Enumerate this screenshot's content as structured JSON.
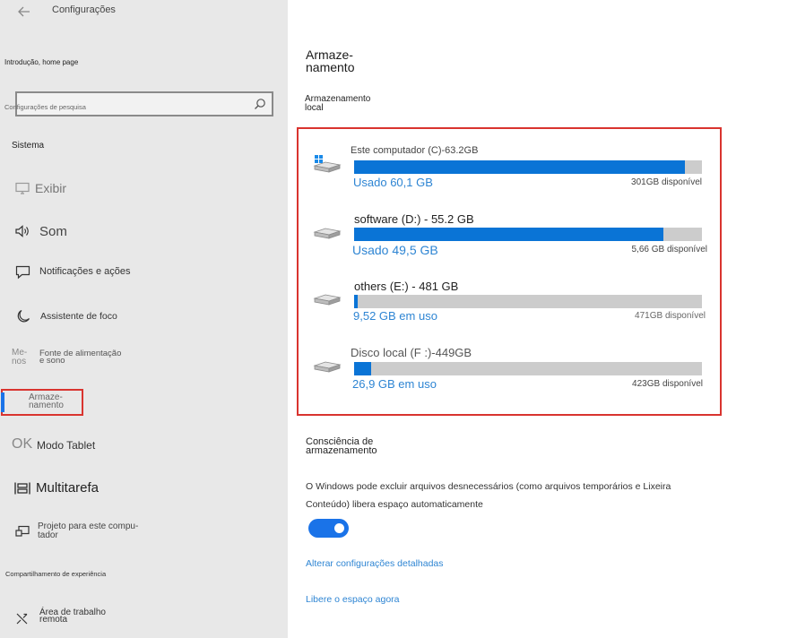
{
  "window": {
    "title": "Configurações"
  },
  "sidebar": {
    "home": "Introdução, home page",
    "search_placeholder": "Configurações de pesquisa",
    "section": "Sistema",
    "items": [
      {
        "label": "Exibir",
        "icon": "monitor-icon"
      },
      {
        "label": "Som",
        "icon": "speaker-icon"
      },
      {
        "label": "Notificações e ações",
        "icon": "notification-icon"
      },
      {
        "label": "Assistente de foco",
        "icon": "moon-icon"
      },
      {
        "icon_text": "Me-\nnos",
        "label": "Fonte de alimentação\ne sono",
        "icon": "power-icon"
      },
      {
        "label": "Armaze-\nnamento",
        "icon": "storage-icon",
        "selected": true
      },
      {
        "icon_text": "OK",
        "label": "Modo Tablet",
        "icon": "tablet-icon"
      },
      {
        "label": "Multitarefa",
        "icon": "multitask-icon"
      },
      {
        "label": "Projeto para este compu-\ntador",
        "icon": "project-icon"
      }
    ],
    "footer_section": "Compartilhamento de experiência",
    "footer_items": [
      {
        "label": "Área de trabalho\nremota",
        "icon": "remote-icon"
      }
    ]
  },
  "main": {
    "title": "Armaze-\nnamento",
    "local_label": "Armazenamento\nlocal",
    "drives": [
      {
        "name": "Este computador (C)-63.2GB",
        "used": "Usado 60,1 GB",
        "free": "301GB disponível",
        "fraction": 0.952,
        "windows": true
      },
      {
        "name": "software (D:) - 55.2 GB",
        "used": "Usado 49,5 GB",
        "free": "5,66 GB disponível",
        "fraction": 0.888
      },
      {
        "name": "others (E:) - 481 GB",
        "used": "9,52 GB em uso",
        "free": "471GB disponível",
        "fraction": 0.01
      },
      {
        "name": "Disco local (F :)-449GB",
        "used": "26,9 GB em uso",
        "free": "423GB disponível",
        "fraction": 0.05
      }
    ],
    "sense_title": "Consciência de\narmazenamento",
    "sense_text": "O Windows pode excluir arquivos desnecessários (como arquivos temporários e Lixeira Conteúdo) libera espaço automaticamente",
    "toggle_on": true,
    "link1": "Alterar configurações detalhadas",
    "link2": "Libere o espaço agora"
  },
  "colors": {
    "accent": "#0a74d6",
    "link": "#2e85d3",
    "highlight": "#d9342f",
    "sidebar": "#e8e8e8"
  }
}
